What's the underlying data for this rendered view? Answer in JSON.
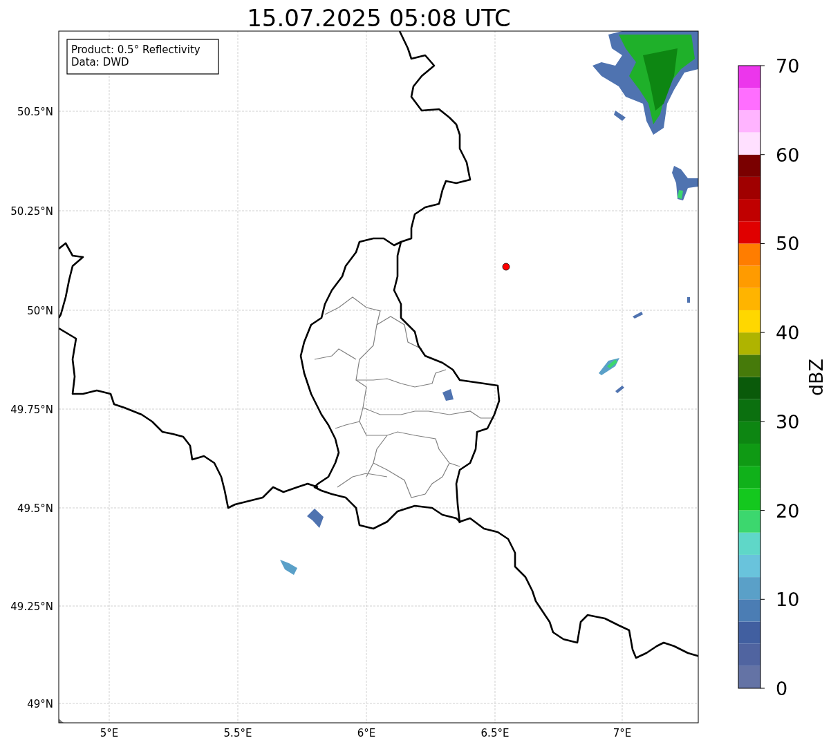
{
  "title": "15.07.2025 05:08 UTC",
  "info_box": [
    "Product: 0.5° Reflectivity",
    "Data: DWD"
  ],
  "x_ticks": [
    "5°E",
    "5.5°E",
    "6°E",
    "6.5°E",
    "7°E"
  ],
  "y_ticks": [
    "50.5°N",
    "50.25°N",
    "50°N",
    "49.75°N",
    "49.5°N",
    "49.25°N",
    "49°N"
  ],
  "colorbar": {
    "label": "dBZ",
    "ticks": [
      "70",
      "60",
      "50",
      "40",
      "30",
      "20",
      "10",
      "0"
    ],
    "segments": [
      {
        "color": "#6473a5"
      },
      {
        "color": "#5064a0"
      },
      {
        "color": "#415fa0"
      },
      {
        "color": "#4b7db4"
      },
      {
        "color": "#5aa0c8"
      },
      {
        "color": "#69c3dc"
      },
      {
        "color": "#5fd7c8"
      },
      {
        "color": "#3cd76e"
      },
      {
        "color": "#14c81e"
      },
      {
        "color": "#10b11a"
      },
      {
        "color": "#0f9a14"
      },
      {
        "color": "#0d8612"
      },
      {
        "color": "#0b700f"
      },
      {
        "color": "#0a5a0a"
      },
      {
        "color": "#467a0a"
      },
      {
        "color": "#afb400"
      },
      {
        "color": "#ffd700"
      },
      {
        "color": "#ffb400"
      },
      {
        "color": "#ff9b00"
      },
      {
        "color": "#ff7d00"
      },
      {
        "color": "#e00000"
      },
      {
        "color": "#c00000"
      },
      {
        "color": "#a00000"
      },
      {
        "color": "#7a0000"
      },
      {
        "color": "#ffe0ff"
      },
      {
        "color": "#ffb4ff"
      },
      {
        "color": "#ff6eff"
      },
      {
        "color": "#ec36ec"
      }
    ]
  }
}
